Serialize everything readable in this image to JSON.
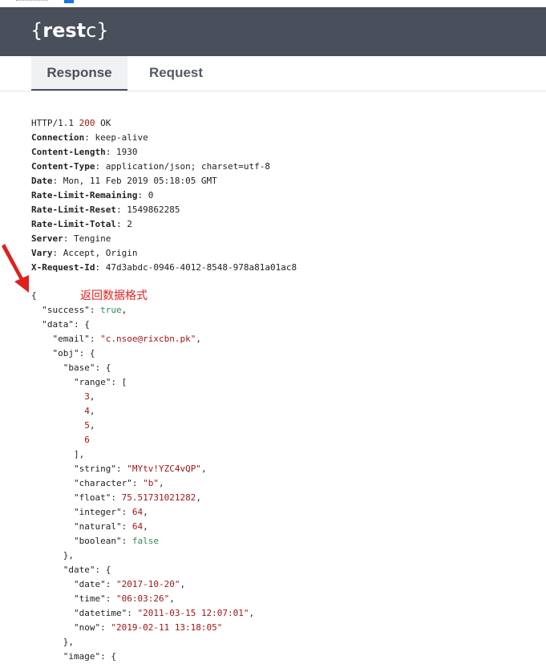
{
  "app": {
    "logo_brace_open": "{",
    "logo_bold": "rest",
    "logo_rest": "c",
    "logo_brace_close": "}"
  },
  "tabs": [
    {
      "label": "Response",
      "active": true
    },
    {
      "label": "Request",
      "active": false
    }
  ],
  "status_line": {
    "protocol": "HTTP/1.1",
    "code": "200",
    "text": "OK"
  },
  "headers": [
    {
      "name": "Connection",
      "value": "keep-alive"
    },
    {
      "name": "Content-Length",
      "value": "1930"
    },
    {
      "name": "Content-Type",
      "value": "application/json; charset=utf-8"
    },
    {
      "name": "Date",
      "value": "Mon, 11 Feb 2019 05:18:05 GMT"
    },
    {
      "name": "Rate-Limit-Remaining",
      "value": "0"
    },
    {
      "name": "Rate-Limit-Reset",
      "value": "1549862285"
    },
    {
      "name": "Rate-Limit-Total",
      "value": "2"
    },
    {
      "name": "Server",
      "value": "Tengine"
    },
    {
      "name": "Vary",
      "value": "Accept, Origin"
    },
    {
      "name": "X-Request-Id",
      "value": "47d3abdc-0946-4012-8548-978a81a01ac8"
    }
  ],
  "annotation": "返回数据格式",
  "body_lines": [
    {
      "indent": 0,
      "parts": [
        {
          "t": "p",
          "v": "{"
        }
      ]
    },
    {
      "indent": 1,
      "parts": [
        {
          "t": "p",
          "v": "\"success\": "
        },
        {
          "t": "b",
          "v": "true"
        },
        {
          "t": "p",
          "v": ","
        }
      ]
    },
    {
      "indent": 1,
      "parts": [
        {
          "t": "p",
          "v": "\"data\": {"
        }
      ]
    },
    {
      "indent": 2,
      "parts": [
        {
          "t": "p",
          "v": "\"email\": "
        },
        {
          "t": "s",
          "v": "\"c.nsoe@rixcbn.pk\""
        },
        {
          "t": "p",
          "v": ","
        }
      ]
    },
    {
      "indent": 2,
      "parts": [
        {
          "t": "p",
          "v": "\"obj\": {"
        }
      ]
    },
    {
      "indent": 3,
      "parts": [
        {
          "t": "p",
          "v": "\"base\": {"
        }
      ]
    },
    {
      "indent": 4,
      "parts": [
        {
          "t": "p",
          "v": "\"range\": ["
        }
      ]
    },
    {
      "indent": 5,
      "parts": [
        {
          "t": "n",
          "v": "3"
        },
        {
          "t": "p",
          "v": ","
        }
      ]
    },
    {
      "indent": 5,
      "parts": [
        {
          "t": "n",
          "v": "4"
        },
        {
          "t": "p",
          "v": ","
        }
      ]
    },
    {
      "indent": 5,
      "parts": [
        {
          "t": "n",
          "v": "5"
        },
        {
          "t": "p",
          "v": ","
        }
      ]
    },
    {
      "indent": 5,
      "parts": [
        {
          "t": "n",
          "v": "6"
        }
      ]
    },
    {
      "indent": 4,
      "parts": [
        {
          "t": "p",
          "v": "],"
        }
      ]
    },
    {
      "indent": 4,
      "parts": [
        {
          "t": "p",
          "v": "\"string\": "
        },
        {
          "t": "s",
          "v": "\"MYtv!YZC4vQP\""
        },
        {
          "t": "p",
          "v": ","
        }
      ]
    },
    {
      "indent": 4,
      "parts": [
        {
          "t": "p",
          "v": "\"character\": "
        },
        {
          "t": "s",
          "v": "\"b\""
        },
        {
          "t": "p",
          "v": ","
        }
      ]
    },
    {
      "indent": 4,
      "parts": [
        {
          "t": "p",
          "v": "\"float\": "
        },
        {
          "t": "n",
          "v": "75.51731021282"
        },
        {
          "t": "p",
          "v": ","
        }
      ]
    },
    {
      "indent": 4,
      "parts": [
        {
          "t": "p",
          "v": "\"integer\": "
        },
        {
          "t": "n",
          "v": "64"
        },
        {
          "t": "p",
          "v": ","
        }
      ]
    },
    {
      "indent": 4,
      "parts": [
        {
          "t": "p",
          "v": "\"natural\": "
        },
        {
          "t": "n",
          "v": "64"
        },
        {
          "t": "p",
          "v": ","
        }
      ]
    },
    {
      "indent": 4,
      "parts": [
        {
          "t": "p",
          "v": "\"boolean\": "
        },
        {
          "t": "b",
          "v": "false"
        }
      ]
    },
    {
      "indent": 3,
      "parts": [
        {
          "t": "p",
          "v": "},"
        }
      ]
    },
    {
      "indent": 3,
      "parts": [
        {
          "t": "p",
          "v": "\"date\": {"
        }
      ]
    },
    {
      "indent": 4,
      "parts": [
        {
          "t": "p",
          "v": "\"date\": "
        },
        {
          "t": "s",
          "v": "\"2017-10-20\""
        },
        {
          "t": "p",
          "v": ","
        }
      ]
    },
    {
      "indent": 4,
      "parts": [
        {
          "t": "p",
          "v": "\"time\": "
        },
        {
          "t": "s",
          "v": "\"06:03:26\""
        },
        {
          "t": "p",
          "v": ","
        }
      ]
    },
    {
      "indent": 4,
      "parts": [
        {
          "t": "p",
          "v": "\"datetime\": "
        },
        {
          "t": "s",
          "v": "\"2011-03-15 12:07:01\""
        },
        {
          "t": "p",
          "v": ","
        }
      ]
    },
    {
      "indent": 4,
      "parts": [
        {
          "t": "p",
          "v": "\"now\": "
        },
        {
          "t": "s",
          "v": "\"2019-02-11 13:18:05\""
        }
      ]
    },
    {
      "indent": 3,
      "parts": [
        {
          "t": "p",
          "v": "},"
        }
      ]
    },
    {
      "indent": 3,
      "parts": [
        {
          "t": "p",
          "v": "\"image\": {"
        }
      ]
    }
  ],
  "colors": {
    "header_bg": "#4a4f5c",
    "string": "#a31515",
    "boolean": "#2e8b57",
    "annotation": "#e02020"
  }
}
